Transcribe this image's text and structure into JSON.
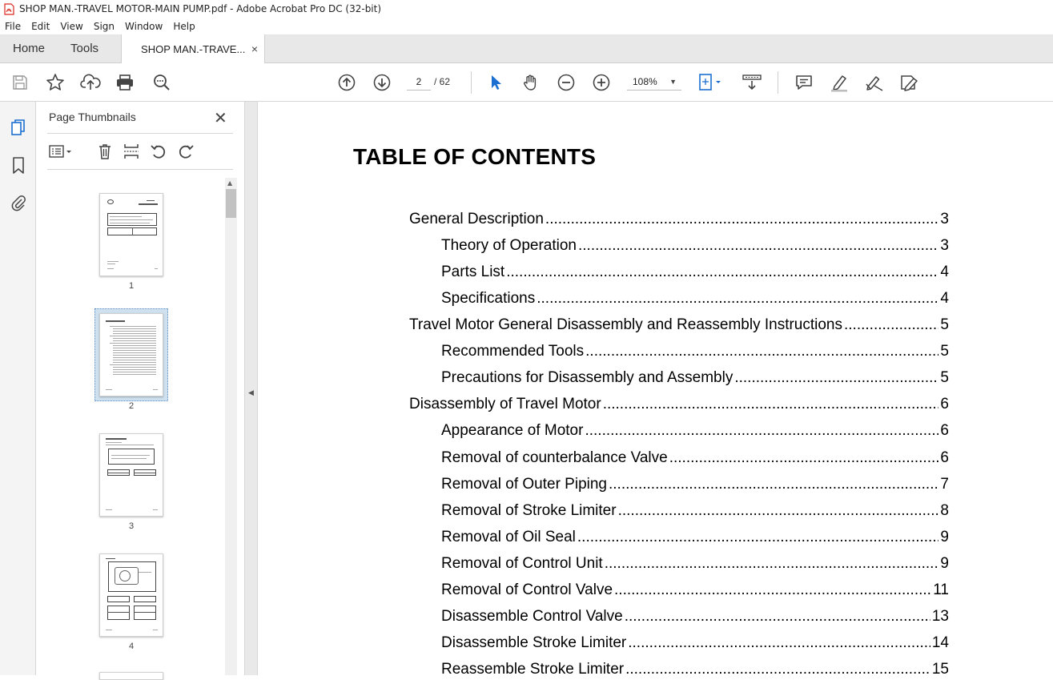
{
  "window": {
    "title": "SHOP MAN.-TRAVEL MOTOR-MAIN PUMP.pdf - Adobe Acrobat Pro DC (32-bit)"
  },
  "menu": [
    "File",
    "Edit",
    "View",
    "Sign",
    "Window",
    "Help"
  ],
  "tabs": {
    "home": "Home",
    "tools": "Tools",
    "document": "SHOP MAN.-TRAVE...",
    "document_close": "×"
  },
  "toolbar": {
    "current_page": "2",
    "page_total": "/ 62",
    "zoom": "108%",
    "zoom_caret": "▼"
  },
  "thumbnails_panel": {
    "title": "Page Thumbnails",
    "close": "✕",
    "pages": [
      {
        "label": "1"
      },
      {
        "label": "2",
        "selected": true
      },
      {
        "label": "3"
      },
      {
        "label": "4"
      }
    ]
  },
  "document": {
    "heading": "TABLE OF CONTENTS",
    "toc": [
      {
        "title": "General Description",
        "page": "3",
        "level": 1
      },
      {
        "title": "Theory of Operation ",
        "page": "3",
        "level": 2
      },
      {
        "title": "Parts List",
        "page": "4",
        "level": 2
      },
      {
        "title": "Specifications",
        "page": "4",
        "level": 2
      },
      {
        "title": "Travel Motor General Disassembly and Reassembly Instructions",
        "page": "5",
        "level": 1
      },
      {
        "title": "Recommended Tools ",
        "page": "5",
        "level": 2
      },
      {
        "title": "Precautions for Disassembly and Assembly ",
        "page": "5",
        "level": 2
      },
      {
        "title": "Disassembly of Travel Motor",
        "page": "6",
        "level": 1
      },
      {
        "title": "Appearance of Motor",
        "page": "6",
        "level": 2
      },
      {
        "title": "Removal of counterbalance Valve",
        "page": "6",
        "level": 2
      },
      {
        "title": "Removal of Outer Piping ",
        "page": "7",
        "level": 2
      },
      {
        "title": "Removal of Stroke Limiter",
        "page": "8",
        "level": 2
      },
      {
        "title": "Removal of Oil Seal ",
        "page": "9",
        "level": 2
      },
      {
        "title": "Removal of Control Unit",
        "page": "9",
        "level": 2
      },
      {
        "title": "Removal of Control Valve",
        "page": "11",
        "level": 2
      },
      {
        "title": "Disassemble Control Valve ",
        "page": "13",
        "level": 2
      },
      {
        "title": "Disassemble Stroke Limiter",
        "page": "14",
        "level": 2
      },
      {
        "title": "Reassemble Stroke Limiter ",
        "page": "15",
        "level": 2
      }
    ]
  }
}
